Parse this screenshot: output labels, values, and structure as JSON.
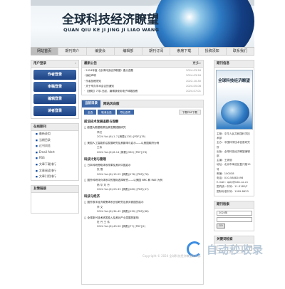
{
  "banner": {
    "title_cn": "全球科技经济瞭望",
    "title_en": "QUAN QIU KE JI JING JI LIAO WANG"
  },
  "nav": [
    "网站首页",
    "期刊简介",
    "编委会",
    "编辑部",
    "期刊订阅",
    "索席下载",
    "投稿须知",
    "联系我们"
  ],
  "left": {
    "user_title": "用户登录",
    "user_more": "›",
    "buttons": [
      "作者登录",
      "审稿登录",
      "编辑登录",
      "读者登录"
    ],
    "journal_title": "在线期刊",
    "journal_links": [
      "最新录用",
      "当期目录",
      "过刊浏览",
      "Email Alert",
      "RSS",
      "文章下载排行",
      "文章阅读排行",
      "文章引用排行"
    ],
    "links_title": "友情链接"
  },
  "main": {
    "notice_title": "最新公告",
    "notice_more": "更多»",
    "notices": [
      {
        "t": "· 2024年度《全球科技经济瞭望》重点选题",
        "d": "2024-03-26"
      },
      {
        "t": "· 版权声明",
        "d": "2024-03-26"
      },
      {
        "t": "· 作者投稿须知",
        "d": "2022-10-30"
      },
      {
        "t": "· 关于举办学术会议的通知",
        "d": "2024-05-08"
      },
      {
        "t": "· 【通知】7月1日起，编辑部使用电子邮箱投稿",
        "d": "2024-07-01"
      }
    ],
    "section_tab": "当前目录",
    "section_tab2": "网站风向版",
    "tabs": [
      "全选",
      "取消全选",
      "导出选项"
    ],
    "download": "下载PDF下载",
    "groups": [
      {
        "name": "前沿技术发展追踪与观察",
        "articles": [
          {
            "title": "□ 欧盟大数据政策及其发展措施研究",
            "authors": "李红",
            "meta": "2024 Vol.(6):1-7  [摘要](130)  [PDF](78)"
          },
          {
            "title": "□ 美国人工智能前沿发展研究及其影响与启示——以美国政府为例",
            "authors": "王伟",
            "meta": "2024 Vol.(6):8-14  [摘要](330)  [PDF](78)"
          }
        ]
      },
      {
        "name": "科技计划与管理",
        "articles": [
          {
            "title": "□ 日本科研资助体系改革及其对中国启示",
            "authors": "张 雪",
            "meta": "2024 Vol.(6):15-22  [摘要](176)  [PDF](76)"
          },
          {
            "title": "□ 国外科研评价体系中的指标选择研究——以美国 NRC 和 RAE 为例",
            "authors": "杨 华 刘 丹",
            "meta": "2024 Vol.(6):23-33  [摘要](180)  [PDF](47)"
          }
        ]
      },
      {
        "name": "科技与经济",
        "articles": [
          {
            "title": "□ 国外数字经济政策体系比较研究及其对我国的启示",
            "authors": "李 文",
            "meta": "2024 Vol.(6):34-42  [摘要](130)  [PDF](68)"
          },
          {
            "title": "□ 全球新兴技术研发投入及其对产业发展的影响",
            "authors": "杜 丹 王 伟",
            "meta": "2024 Vol.(6):43-50  [摘要](77)  [PDF](2)"
          }
        ]
      }
    ]
  },
  "right": {
    "cover_title": "期刊信息",
    "cover_text": "全球科技经济瞭望",
    "info": [
      "主管：中华人民共和国科学技术部",
      "主办：中国科学技术信息研究所",
      "出版：全球科技经济瞭望编辑部",
      "主编：王秀丽",
      "地址：北京市海淀区复兴路15号",
      "邮编：100038",
      "电话：010-58882498",
      "E-mail：qqkj@istic.ac.cn",
      "国内统一刊号：11-3182/F",
      "国际标准刊号：1009-8623"
    ],
    "period_title": "期刊检索",
    "period_sel": "2024年",
    "period_go": "GO",
    "kw_title": "关键词检索"
  },
  "watermark": {
    "text": "自动秒收录",
    "sub": "Copyright © 2024 全球科技经济瞭望编辑部"
  }
}
